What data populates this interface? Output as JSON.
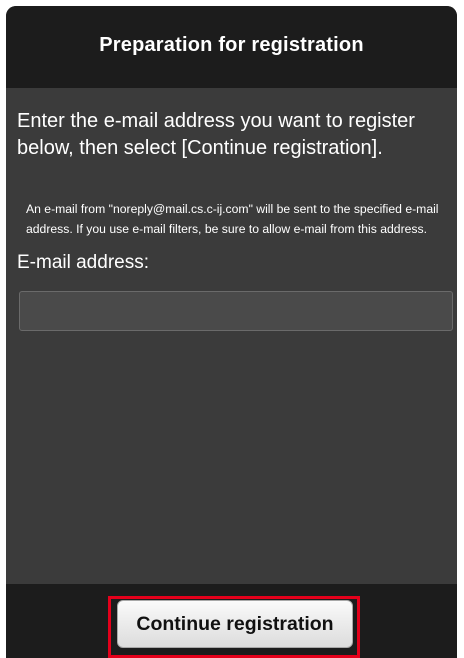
{
  "header": {
    "title": "Preparation for registration"
  },
  "main": {
    "instruction": "Enter the e-mail address you want to register below, then select [Continue registration].",
    "notice": "An e-mail from \"noreply@mail.cs.c-ij.com\" will be sent to the specified e-mail address. If you use e-mail filters, be sure to allow e-mail from this address.",
    "email_label": "E-mail address:",
    "email_value": "",
    "email_placeholder": ""
  },
  "footer": {
    "continue_label": "Continue registration",
    "highlight_color": "#e4001b"
  },
  "colors": {
    "header_background": "#1c1c1c",
    "content_background": "#3b3b3b",
    "text": "#ffffff"
  }
}
